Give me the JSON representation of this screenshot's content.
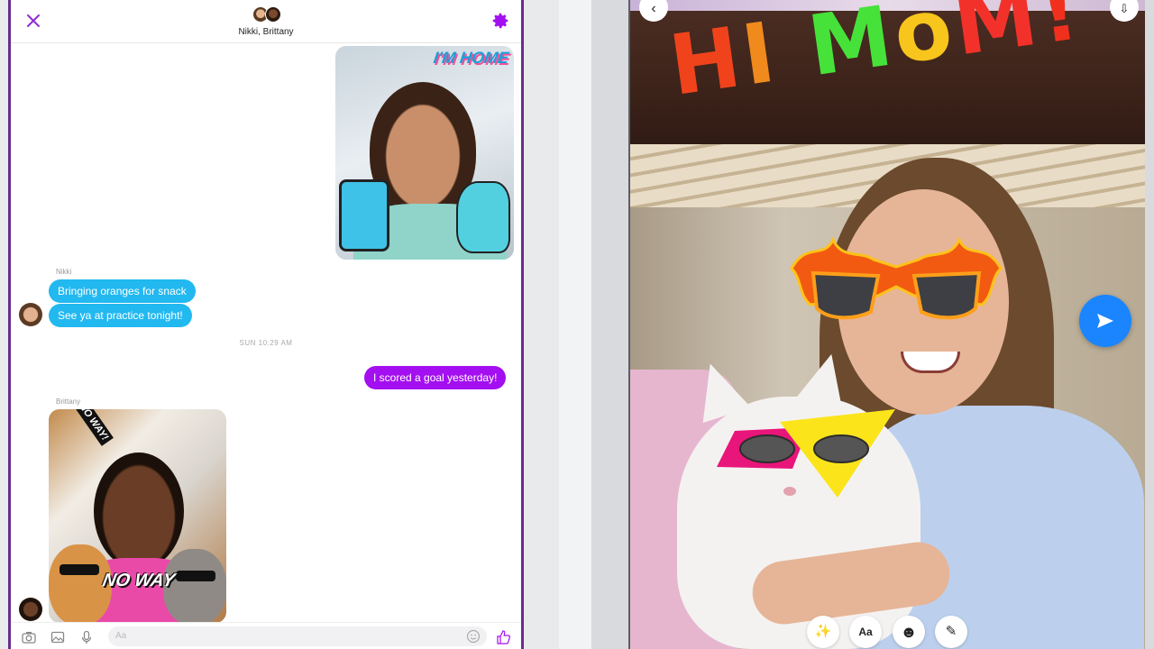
{
  "chat": {
    "header": {
      "participants": "Nikki, Brittany"
    },
    "messages": {
      "nikki_name": "Nikki",
      "nikki_1": "Bringing oranges for snack",
      "nikki_2": "See ya at practice tonight!",
      "timestamp": "SUN 10:29 AM",
      "mine_1": "I scored a goal yesterday!",
      "brittany_name": "Brittany"
    },
    "stickers": {
      "im_home": "I'M HOME",
      "no_way_sign": "NO WAY!",
      "no_way_big": "NO WAY"
    },
    "composer": {
      "placeholder": "Aa"
    }
  },
  "camera": {
    "drawing_text": [
      "H",
      "I",
      " ",
      "M",
      "o",
      "M",
      "!"
    ],
    "drawing_colors": [
      "#f0431c",
      "#f08a1c",
      "#ffffff",
      "#46e23a",
      "#f7c51c",
      "#f2322a",
      "#f0301d"
    ],
    "tools": [
      {
        "name": "effects",
        "icon": "magic-wand-icon",
        "glyph": "✨"
      },
      {
        "name": "text",
        "icon": "text-icon",
        "glyph": "Aa"
      },
      {
        "name": "stickers",
        "icon": "smiley-icon",
        "glyph": "☻"
      },
      {
        "name": "draw",
        "icon": "brush-icon",
        "glyph": "✎"
      }
    ]
  },
  "colors": {
    "accent_purple": "#a30ff0",
    "incoming_blue": "#22b8f0",
    "send_blue": "#1a85ff"
  }
}
